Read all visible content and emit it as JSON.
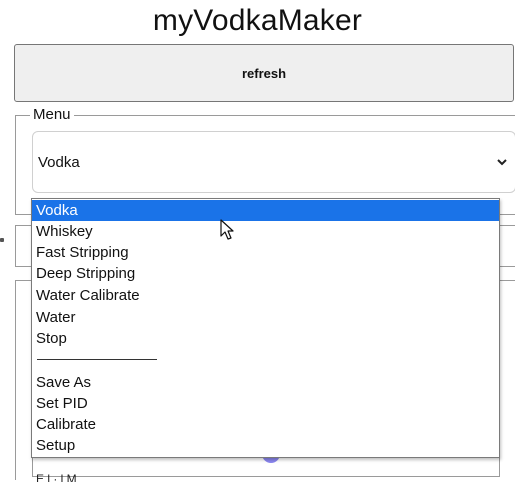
{
  "page": {
    "title": "myVodkaMaker"
  },
  "toolbar": {
    "refresh_label": "refresh"
  },
  "menu": {
    "legend": "Menu",
    "selected": "Vodka",
    "options": [
      "Vodka",
      "Whiskey",
      "Fast Stripping",
      "Deep Stripping",
      "Water Calibrate",
      "Water",
      "Stop",
      "Save As",
      "Set PID",
      "Calibrate",
      "Setup"
    ]
  },
  "lower": {
    "partial_text": "E  l          ·  l            M"
  },
  "colors": {
    "highlight": "#1a73e8",
    "accent_blob": "#8b86f0"
  },
  "icons": {
    "select_arrow": "chevron-down-icon",
    "pointer": "cursor-arrow-icon"
  }
}
